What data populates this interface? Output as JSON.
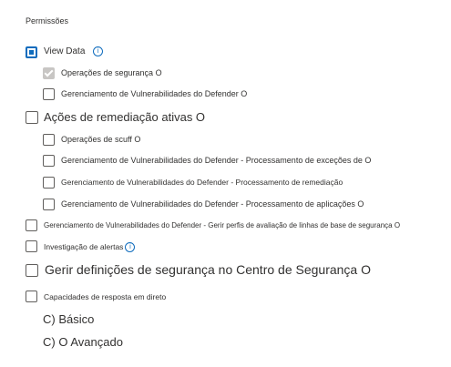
{
  "section_title": "Permissões",
  "info_icon_glyph": "i",
  "view_data": {
    "label": "View Data",
    "checked": true
  },
  "view_data_children": [
    {
      "label": "Operações de segurança O",
      "state": "checked-disabled"
    },
    {
      "label": "Gerenciamento de Vulnerabilidades do Defender O",
      "state": "unchecked"
    }
  ],
  "remediation": {
    "label": "Ações de remediação ativas O"
  },
  "remediation_children": [
    {
      "label": "Operações de scuff O"
    },
    {
      "label": "Gerenciamento de Vulnerabilidades do Defender - Processamento de exceções de O"
    },
    {
      "label": "Gerenciamento de Vulnerabilidades do Defender - Processamento de remediação"
    },
    {
      "label": "Gerenciamento de Vulnerabilidades do Defender - Processamento de aplicações O"
    }
  ],
  "baseline": {
    "label": "Gerenciamento de Vulnerabilidades do Defender - Gerir perfis de avaliação de linhas de base de segurança O"
  },
  "alerts": {
    "label": "Investigação de alertas"
  },
  "manage_settings": {
    "label": "Gerir definições de segurança no Centro de Segurança O"
  },
  "live_response": {
    "label": "Capacidades de resposta em direto"
  },
  "live_options": [
    {
      "label": "C) Básico"
    },
    {
      "label": "C) O Avançado"
    }
  ]
}
